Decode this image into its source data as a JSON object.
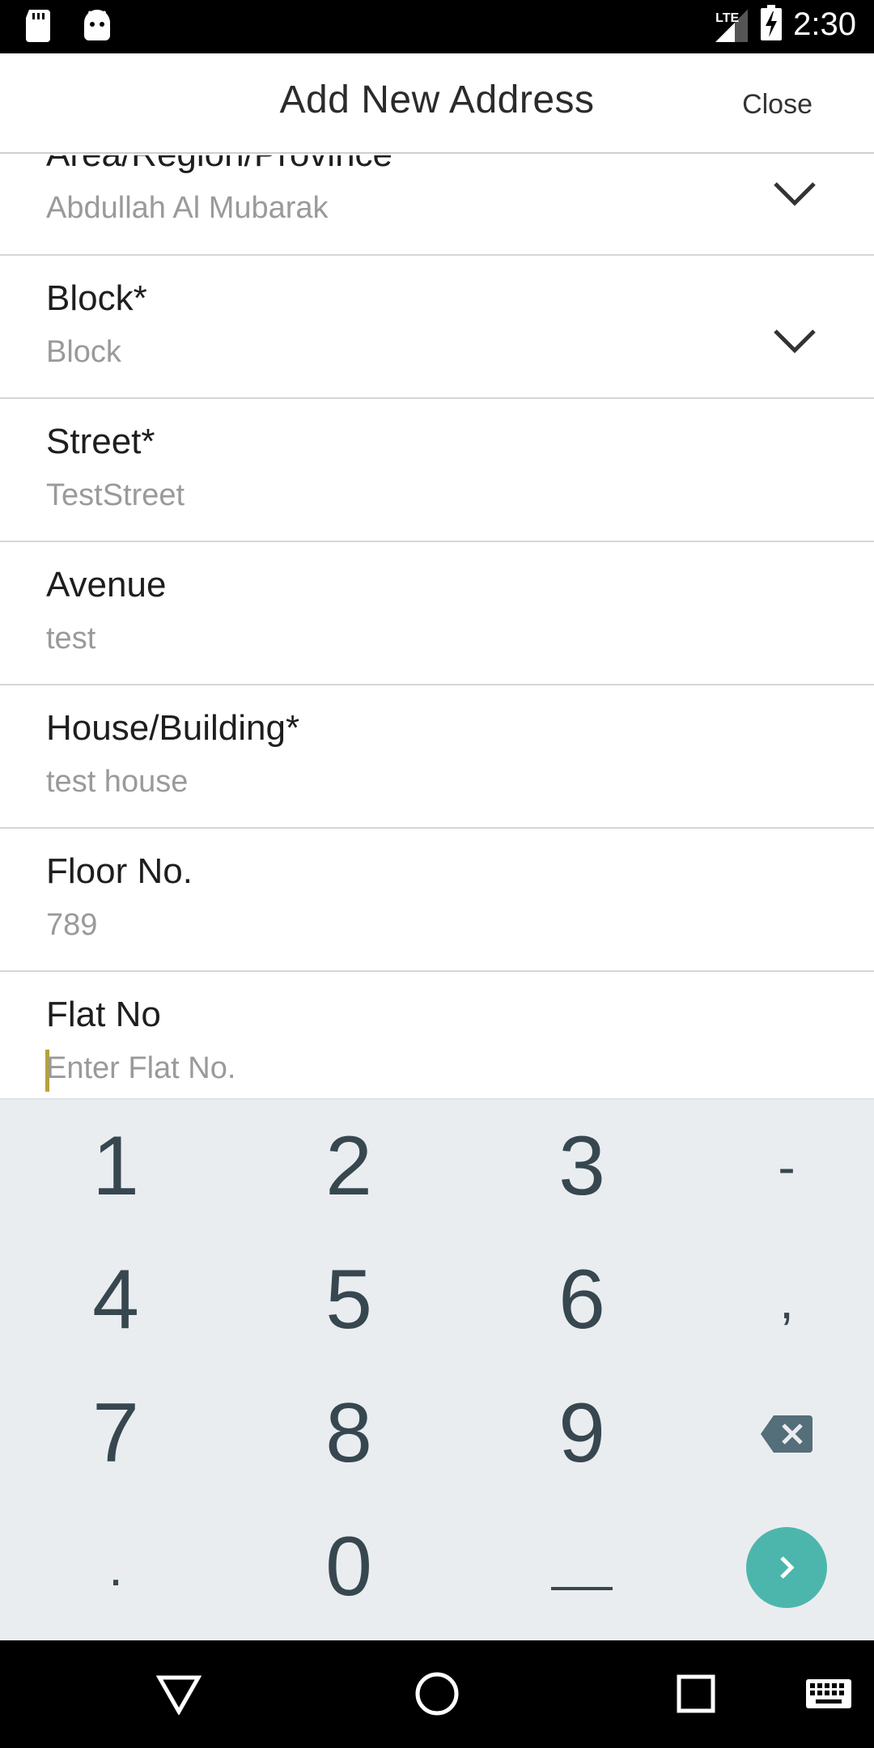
{
  "status_bar": {
    "time": "2:30",
    "network": "LTE",
    "icons": [
      "sd-card-icon",
      "android-icon",
      "signal-icon",
      "battery-charging-icon"
    ]
  },
  "app_bar": {
    "title": "Add New Address",
    "close_label": "Close"
  },
  "form": {
    "fields": [
      {
        "label": "Area/Region/Province*",
        "value": "Abdullah Al Mubarak",
        "type": "dropdown"
      },
      {
        "label": "Block*",
        "value": "Block",
        "type": "dropdown"
      },
      {
        "label": "Street*",
        "value": "TestStreet",
        "type": "text"
      },
      {
        "label": "Avenue",
        "value": "test",
        "type": "text"
      },
      {
        "label": "House/Building*",
        "value": "test house",
        "type": "text"
      },
      {
        "label": "Floor No.",
        "value": "789",
        "type": "text"
      },
      {
        "label": "Flat No",
        "placeholder": "Enter Flat No.",
        "value": "",
        "type": "text",
        "focused": true
      }
    ]
  },
  "keyboard": {
    "keys": [
      "1",
      "2",
      "3",
      "-",
      "4",
      "5",
      "6",
      ",",
      "7",
      "8",
      "9",
      ".",
      "0"
    ],
    "icons": [
      "backspace-icon",
      "space-key",
      "enter-next-icon"
    ],
    "accent_color": "#4db6ac"
  },
  "nav_bar": {
    "icons": [
      "back-icon",
      "home-icon",
      "recents-icon",
      "keyboard-icon"
    ]
  }
}
